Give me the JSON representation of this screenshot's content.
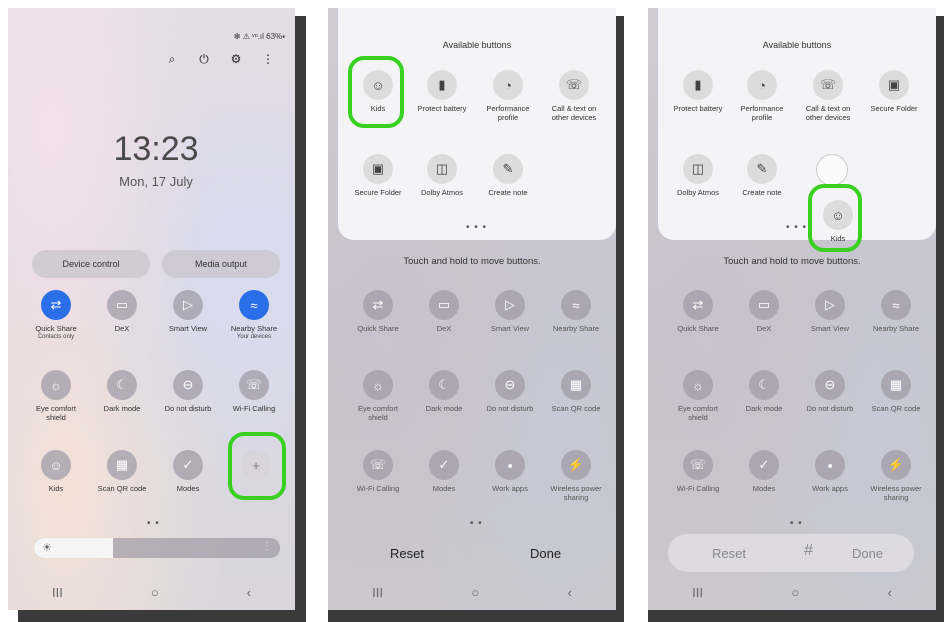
{
  "phone1": {
    "status_text": "✻ ⚠ ᵛᵒ.ıl 63%▪",
    "header_icons": [
      "search-icon",
      "power-icon",
      "gear-icon",
      "more-icon"
    ],
    "time": "13:23",
    "date": "Mon, 17 July",
    "device_control": "Device control",
    "media_output": "Media output",
    "tiles": [
      {
        "label": "Quick Share",
        "sub": "Contacts only",
        "icon": "share-icon",
        "on": true
      },
      {
        "label": "DeX",
        "sub": "",
        "icon": "dex-icon",
        "on": false
      },
      {
        "label": "Smart View",
        "sub": "",
        "icon": "smart-view-icon",
        "on": false
      },
      {
        "label": "Nearby Share",
        "sub": "Your devices",
        "icon": "nearby-share-icon",
        "on": true
      },
      {
        "label": "Eye comfort shield",
        "sub": "",
        "icon": "eye-comfort-icon",
        "on": false
      },
      {
        "label": "Dark mode",
        "sub": "",
        "icon": "moon-icon",
        "on": false
      },
      {
        "label": "Do not disturb",
        "sub": "",
        "icon": "dnd-icon",
        "on": false
      },
      {
        "label": "Wi-Fi Calling",
        "sub": "",
        "icon": "wifi-calling-icon",
        "on": false
      },
      {
        "label": "Kids",
        "sub": "",
        "icon": "kids-icon",
        "on": false
      },
      {
        "label": "Scan QR code",
        "sub": "",
        "icon": "qr-icon",
        "on": false
      },
      {
        "label": "Modes",
        "sub": "",
        "icon": "modes-icon",
        "on": false
      }
    ],
    "add_button": "+",
    "page_dots": "• •",
    "brightness_level": 0.32
  },
  "phone2": {
    "available_title": "Available buttons",
    "available": [
      {
        "label": "Kids",
        "icon": "kids-icon"
      },
      {
        "label": "Protect battery",
        "icon": "battery-icon"
      },
      {
        "label": "Performance profile",
        "icon": "performance-icon"
      },
      {
        "label": "Call & text on other devices",
        "icon": "call-text-icon"
      },
      {
        "label": "Secure Folder",
        "icon": "secure-folder-icon"
      },
      {
        "label": "Dolby Atmos",
        "icon": "dolby-icon"
      },
      {
        "label": "Create note",
        "icon": "create-note-icon"
      }
    ],
    "panel_dots": "• • •",
    "hint": "Touch and hold to move buttons.",
    "tiles": [
      {
        "label": "Quick Share",
        "icon": "share-icon"
      },
      {
        "label": "DeX",
        "icon": "dex-icon"
      },
      {
        "label": "Smart View",
        "icon": "smart-view-icon"
      },
      {
        "label": "Nearby Share",
        "icon": "nearby-share-icon"
      },
      {
        "label": "Eye comfort shield",
        "icon": "eye-comfort-icon"
      },
      {
        "label": "Dark mode",
        "icon": "moon-icon"
      },
      {
        "label": "Do not disturb",
        "icon": "dnd-icon"
      },
      {
        "label": "Scan QR code",
        "icon": "qr-icon"
      },
      {
        "label": "Wi-Fi Calling",
        "icon": "wifi-calling-icon"
      },
      {
        "label": "Modes",
        "icon": "modes-icon"
      },
      {
        "label": "Work apps",
        "icon": "work-apps-icon"
      },
      {
        "label": "Wireless power sharing",
        "icon": "wireless-power-icon"
      }
    ],
    "reset": "Reset",
    "done": "Done"
  },
  "phone3": {
    "available_title": "Available buttons",
    "available": [
      {
        "label": "Protect battery",
        "icon": "battery-icon"
      },
      {
        "label": "Performance profile",
        "icon": "performance-icon"
      },
      {
        "label": "Call & text on other devices",
        "icon": "call-text-icon"
      },
      {
        "label": "Secure Folder",
        "icon": "secure-folder-icon"
      },
      {
        "label": "Dolby Atmos",
        "icon": "dolby-icon"
      },
      {
        "label": "Create note",
        "icon": "create-note-icon"
      }
    ],
    "dragging": {
      "label": "Kids",
      "icon": "kids-icon"
    },
    "hint": "Touch and hold to move buttons.",
    "tiles": [
      {
        "label": "Quick Share",
        "icon": "share-icon"
      },
      {
        "label": "DeX",
        "icon": "dex-icon"
      },
      {
        "label": "Smart View",
        "icon": "smart-view-icon"
      },
      {
        "label": "Nearby Share",
        "icon": "nearby-share-icon"
      },
      {
        "label": "Eye comfort shield",
        "icon": "eye-comfort-icon"
      },
      {
        "label": "Dark mode",
        "icon": "moon-icon"
      },
      {
        "label": "Do not disturb",
        "icon": "dnd-icon"
      },
      {
        "label": "Scan QR code",
        "icon": "qr-icon"
      },
      {
        "label": "Wi-Fi Calling",
        "icon": "wifi-calling-icon"
      },
      {
        "label": "Modes",
        "icon": "modes-icon"
      },
      {
        "label": "Work apps",
        "icon": "work-apps-icon"
      },
      {
        "label": "Wireless power sharing",
        "icon": "wireless-power-icon"
      }
    ],
    "reset": "Reset",
    "done": "Done",
    "keyboard_symbol": "#"
  },
  "nav": {
    "recents": "III",
    "home": "○",
    "back": "‹"
  },
  "colors": {
    "highlight": "#3ad022",
    "toggle_on": "#2b6fe8"
  }
}
